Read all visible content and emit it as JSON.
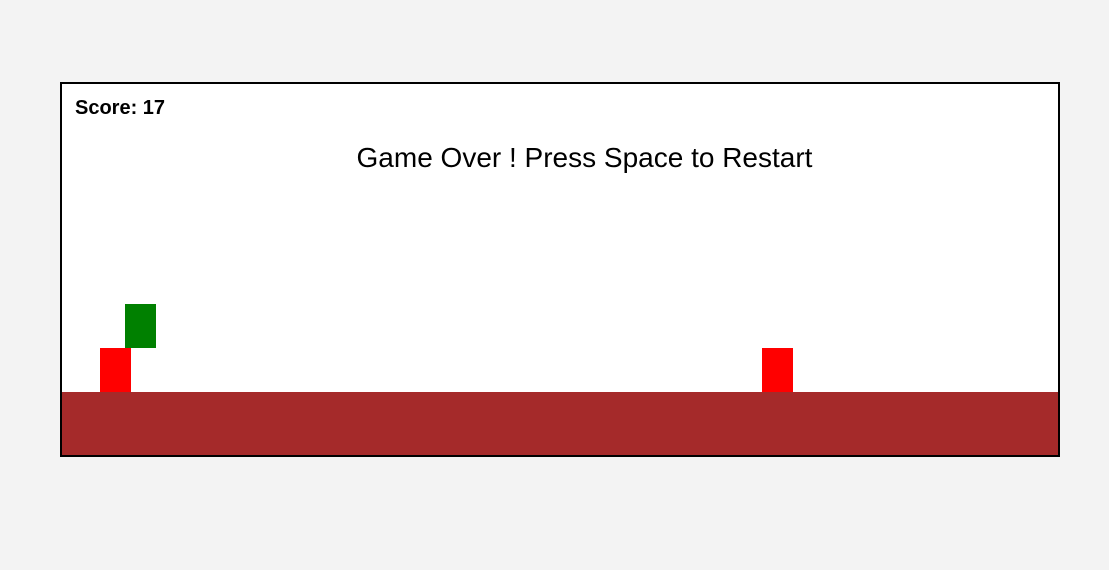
{
  "hud": {
    "score_label": "Score: 17"
  },
  "status": {
    "message": "Game Over ! Press Space to Restart"
  },
  "colors": {
    "background": "#f3f3f3",
    "canvas": "#ffffff",
    "ground": "#a52a2a",
    "obstacle": "#ff0000",
    "player": "#008000"
  }
}
